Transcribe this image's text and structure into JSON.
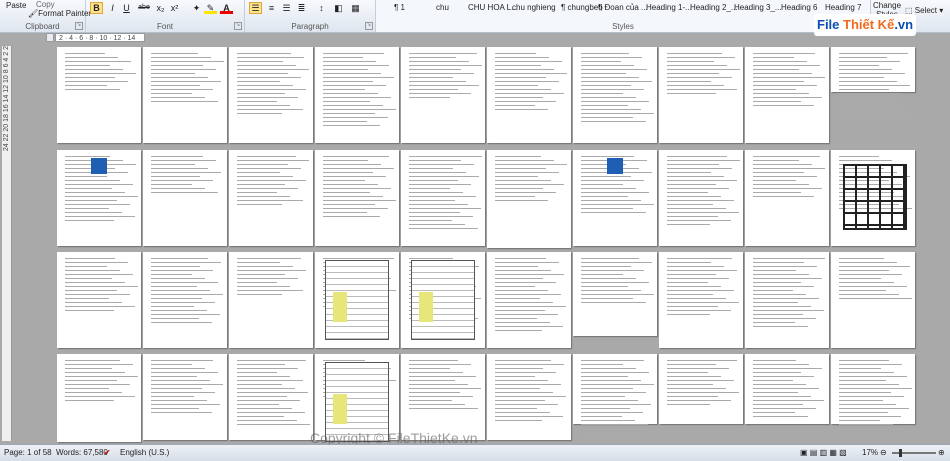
{
  "ribbon": {
    "clipboard": {
      "paste": "Paste",
      "copy": "Copy",
      "format_painter": "Format Painter",
      "label": "Clipboard"
    },
    "font": {
      "label": "Font",
      "bold": "B",
      "italic": "I",
      "underline": "U",
      "strike": "abe",
      "subscript": "x₂",
      "superscript": "x²",
      "font_color": "A"
    },
    "paragraph": {
      "label": "Paragraph",
      "show_marks": "¶"
    },
    "styles": {
      "label": "Styles",
      "items": [
        "¶ 1",
        "chu",
        "CHU HOA L...",
        "chu nghieng",
        "¶ chungbeo",
        "¶ Đoan của ...",
        "Heading 1-...",
        "Heading 2_...",
        "Heading 3_...",
        "Heading 6",
        "Heading 7"
      ],
      "change_styles": "Change Styles"
    },
    "editing": {
      "select": "Select"
    },
    "logo": {
      "text_a": "File ",
      "text_b": "Thiết Kế",
      "text_c": ".vn"
    }
  },
  "ruler": {
    "ticks": "2 · 4 · 6 · 8 · 10 · 12 · 14",
    "vertical": "24 22 20 18 16 14 12 10 8 6 4 2 2"
  },
  "status": {
    "page": "Page: 1 of 58",
    "words": "Words: 67,580",
    "language": "English (U.S.)",
    "zoom": "17%",
    "zoom_level": 0.17
  },
  "watermark": "Copyright © FileThietKe.vn",
  "colors": {
    "ribbon": "#dfe6f0",
    "workspace": "#a9a9a9",
    "highlight": "#ffe28a",
    "logo_blue": "#0a4fb3",
    "logo_orange": "#f26b1d"
  }
}
